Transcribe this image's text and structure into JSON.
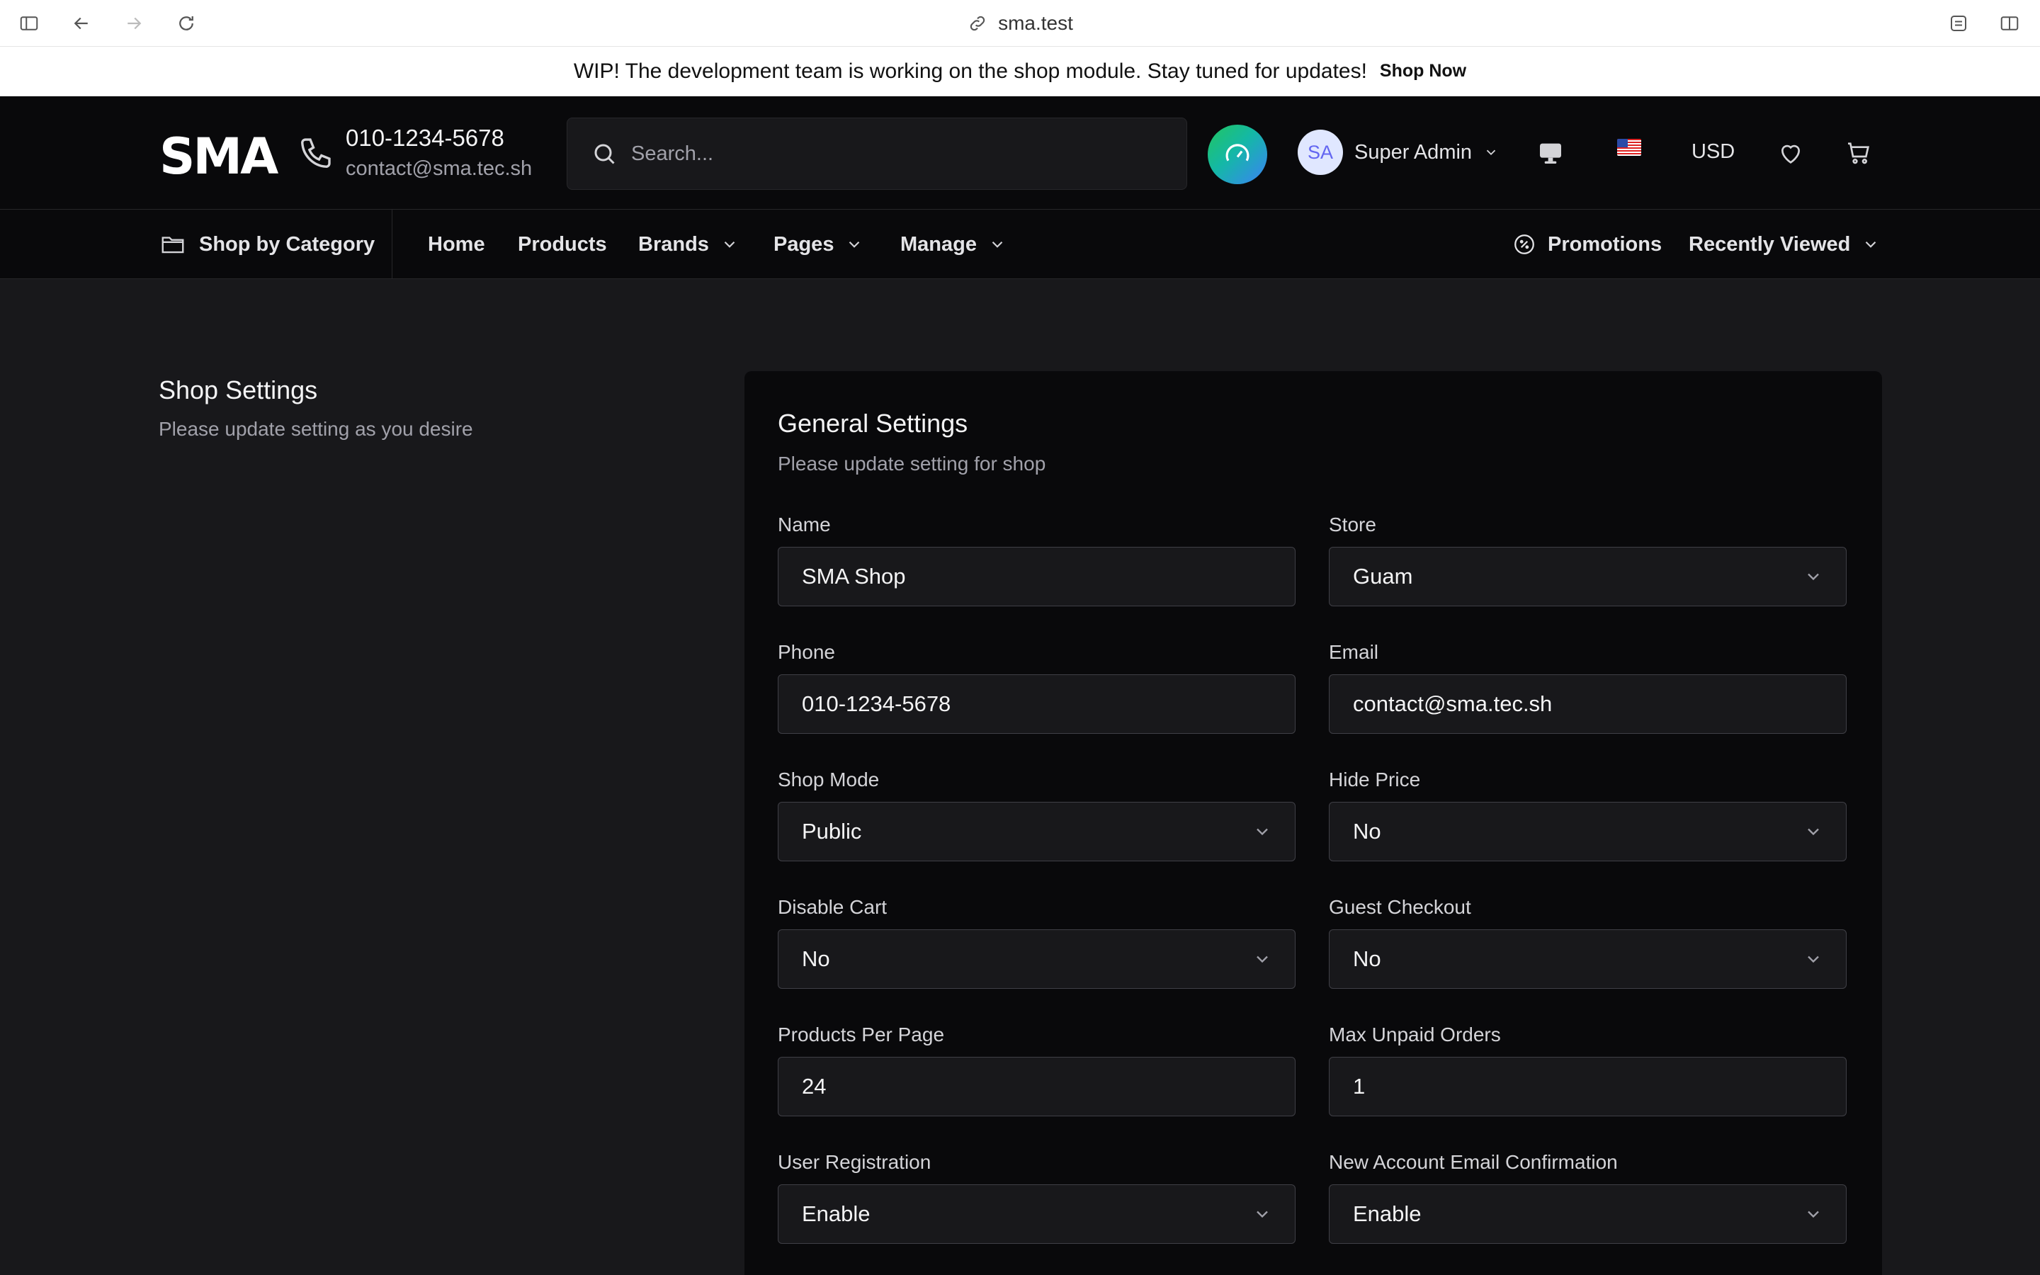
{
  "browser": {
    "url": "sma.test"
  },
  "banner": {
    "text": "WIP! The development team is working on the shop module. Stay tuned for updates!",
    "link": "Shop Now"
  },
  "header": {
    "logo": "SMA",
    "phone": "010-1234-5678",
    "email": "contact@sma.tec.sh",
    "search_placeholder": "Search...",
    "user_initials": "SA",
    "user_name": "Super Admin",
    "currency": "USD",
    "icons": [
      "phone-icon",
      "search-icon",
      "gauge-icon",
      "monitor-icon",
      "us-flag-icon",
      "heart-icon",
      "cart-icon"
    ]
  },
  "nav": {
    "category": "Shop by Category",
    "items": [
      {
        "label": "Home"
      },
      {
        "label": "Products"
      },
      {
        "label": "Brands"
      },
      {
        "label": "Pages"
      },
      {
        "label": "Manage"
      }
    ],
    "promotions": "Promotions",
    "recently_viewed": "Recently Viewed"
  },
  "page": {
    "title": "Shop Settings",
    "description": "Please update setting as you desire"
  },
  "card": {
    "title": "General Settings",
    "description": "Please update setting for shop",
    "fields": {
      "name": {
        "label": "Name",
        "value": "SMA Shop"
      },
      "store": {
        "label": "Store",
        "value": "Guam"
      },
      "phone": {
        "label": "Phone",
        "value": "010-1234-5678"
      },
      "email": {
        "label": "Email",
        "value": "contact@sma.tec.sh"
      },
      "shop_mode": {
        "label": "Shop Mode",
        "value": "Public"
      },
      "hide_price": {
        "label": "Hide Price",
        "value": "No"
      },
      "disable_cart": {
        "label": "Disable Cart",
        "value": "No"
      },
      "guest_checkout": {
        "label": "Guest Checkout",
        "value": "No"
      },
      "products_per_page": {
        "label": "Products Per Page",
        "value": "24"
      },
      "max_unpaid_orders": {
        "label": "Max Unpaid Orders",
        "value": "1"
      },
      "user_registration": {
        "label": "User Registration",
        "value": "Enable"
      },
      "new_account_email_confirmation": {
        "label": "New Account Email Confirmation",
        "value": "Enable"
      }
    }
  },
  "colors": {
    "page_bg": "#18181b",
    "header_bg": "#09090b",
    "card_bg": "#09090b",
    "input_bg": "#18181b",
    "accent_gradient_start": "#22c55e",
    "accent_gradient_end": "#3b82f6"
  }
}
